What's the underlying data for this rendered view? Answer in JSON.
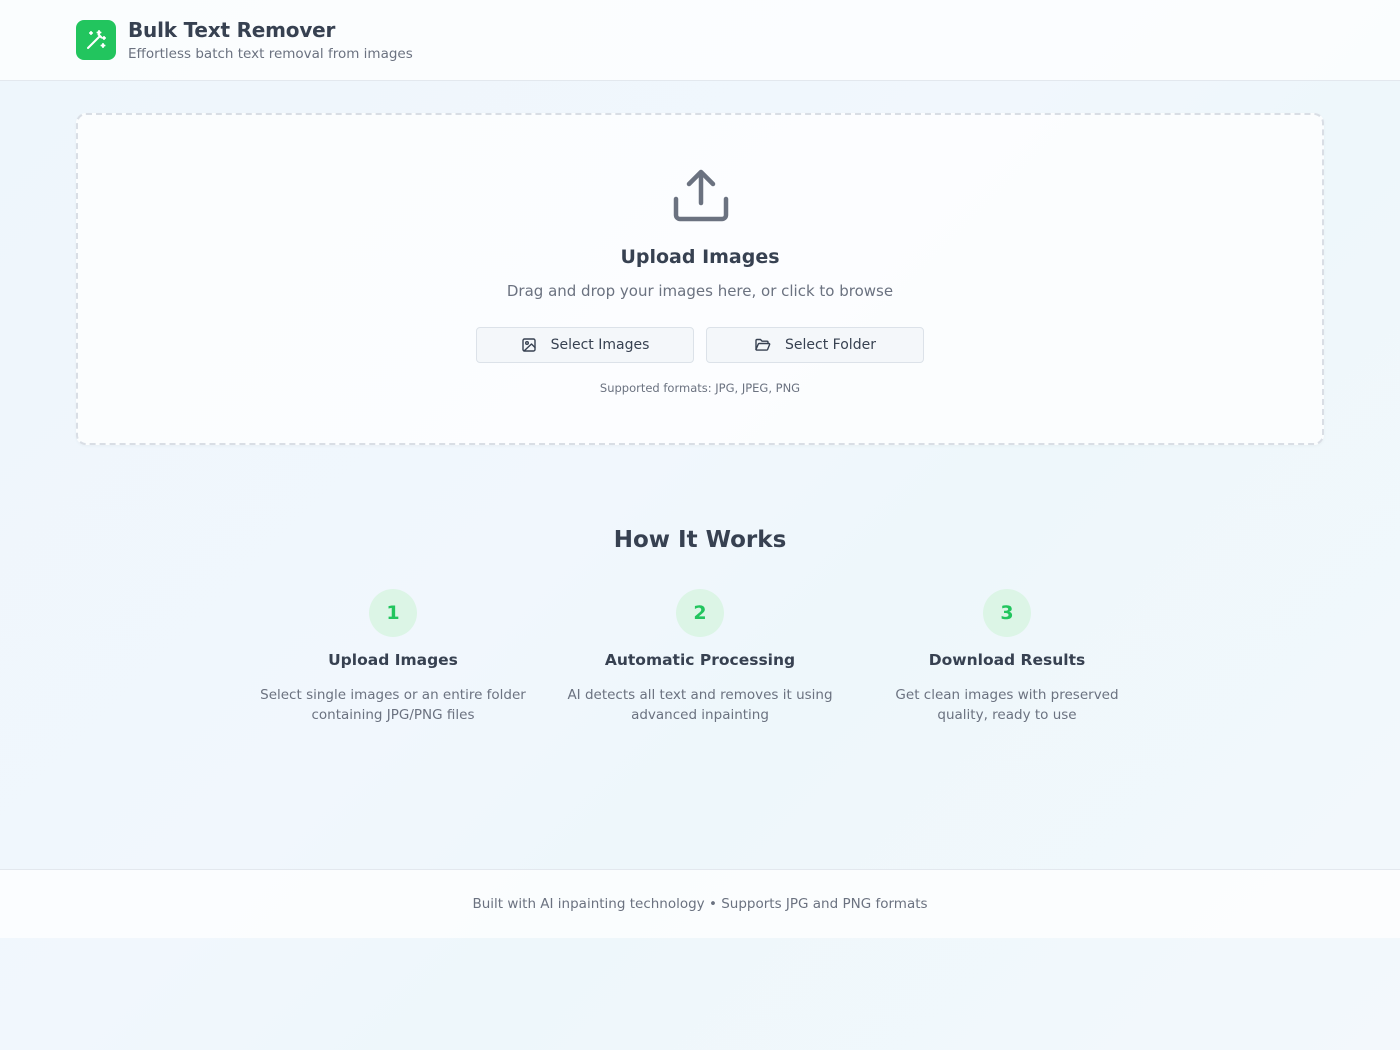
{
  "header": {
    "title": "Bulk Text Remover",
    "subtitle": "Effortless batch text removal from images",
    "logo_icon": "magic-wand-icon",
    "accent_color": "#22c55e"
  },
  "upload": {
    "icon": "upload-icon",
    "title": "Upload Images",
    "description": "Drag and drop your images here, or click to browse",
    "select_images_label": "Select Images",
    "select_folder_label": "Select Folder",
    "formats": "Supported formats: JPG, JPEG, PNG"
  },
  "how_it_works": {
    "title": "How It Works",
    "steps": [
      {
        "number": "1",
        "title": "Upload Images",
        "description": "Select single images or an entire folder containing JPG/PNG files"
      },
      {
        "number": "2",
        "title": "Automatic Processing",
        "description": "AI detects all text and removes it using advanced inpainting"
      },
      {
        "number": "3",
        "title": "Download Results",
        "description": "Get clean images with preserved quality, ready to use"
      }
    ]
  },
  "footer": {
    "text": "Built with AI inpainting technology • Supports JPG and PNG formats"
  }
}
